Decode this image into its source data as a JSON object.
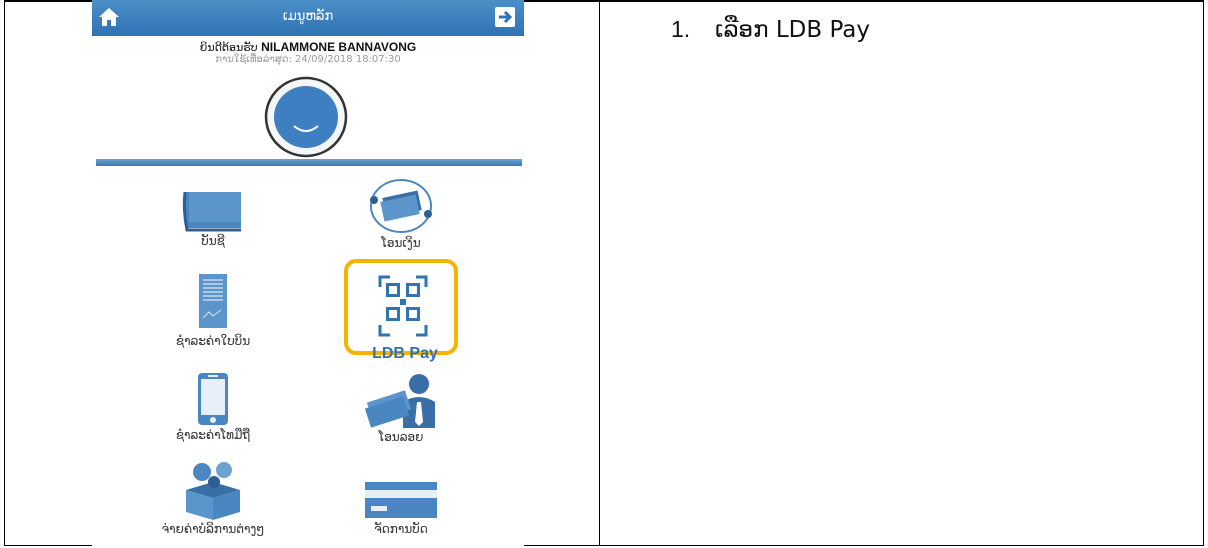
{
  "app": {
    "title": "ເມນູຫລັກ",
    "welcome_prefix": "ຍິນດີຕ້ອນຮັບ",
    "user_name": "NILAMMONE BANNAVONG",
    "last_login": "ການໃຊ້ເທື່ອລ່າສຸດ: 24/09/2018 18:07:30"
  },
  "menu": [
    {
      "label": "ບັນຊີ",
      "icon": "account-book-icon"
    },
    {
      "label": "ໂອນເງິນ",
      "icon": "money-transfer-icon"
    },
    {
      "label": "ຊຳລະຄ່າໃບບິນ",
      "icon": "bill-receipt-icon"
    },
    {
      "label": "LDB Pay",
      "icon": "qr-code-icon"
    },
    {
      "label": "ຊຳລະຄ່າໂທມືຖື",
      "icon": "mobile-phone-icon"
    },
    {
      "label": "ໂອນລອຍ",
      "icon": "money-hand-icon"
    },
    {
      "label": "ຈ່າຍຄ່າບໍລິການຕ່າງໆ",
      "icon": "services-box-icon"
    },
    {
      "label": "ຈັດການບັດ",
      "icon": "card-icon"
    }
  ],
  "instruction": {
    "number": "1.",
    "text": "ເລືອກ LDB Pay"
  },
  "colors": {
    "appbar": "#2f73b4",
    "highlight": "#f4b400"
  }
}
